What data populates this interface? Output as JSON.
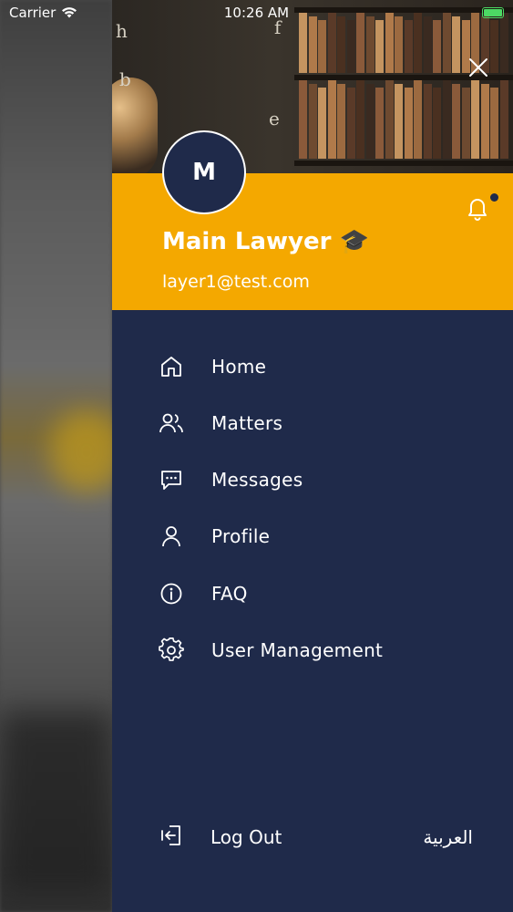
{
  "status_bar": {
    "carrier": "Carrier",
    "time": "10:26 AM",
    "battery_color": "#4cd964"
  },
  "drawer": {
    "close_icon": "close-icon",
    "header_image_icon": "library-bookshelf-image",
    "avatar_initial": "M",
    "user_name": "Main Lawyer 🎓",
    "user_email": "layer1@test.com",
    "notification_icon": "bell-icon",
    "menu": [
      {
        "label": "Home",
        "icon": "home-icon"
      },
      {
        "label": "Matters",
        "icon": "users-icon"
      },
      {
        "label": "Messages",
        "icon": "message-icon"
      },
      {
        "label": "Profile",
        "icon": "user-icon"
      },
      {
        "label": "FAQ",
        "icon": "info-icon"
      },
      {
        "label": "User Management",
        "icon": "gear-icon"
      }
    ],
    "logout_label": "Log Out",
    "language_toggle": "العربية"
  },
  "colors": {
    "drawer_bg": "#1f2a4a",
    "profile_bg": "#f4a800",
    "text": "#ffffff"
  }
}
